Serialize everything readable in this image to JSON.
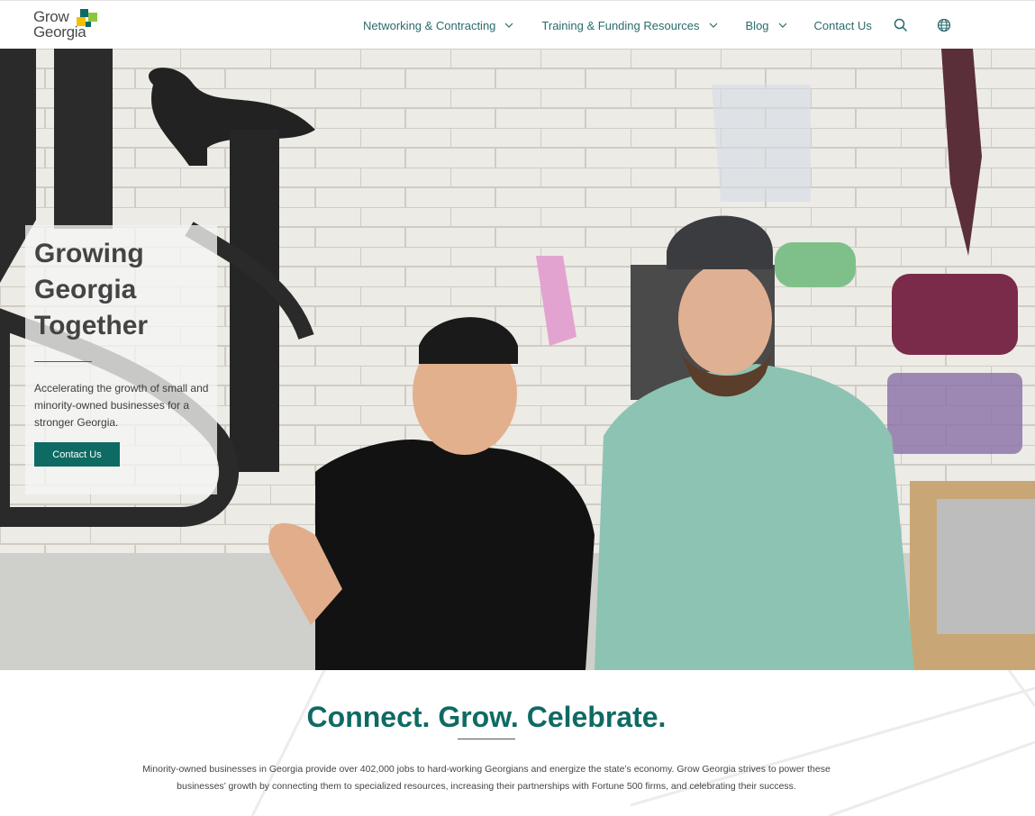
{
  "header": {
    "logo": {
      "line1": "Grow",
      "line2": "Georgia"
    },
    "nav": [
      {
        "label": "Networking & Contracting",
        "has_dropdown": true
      },
      {
        "label": "Training & Funding Resources",
        "has_dropdown": true
      },
      {
        "label": "Blog",
        "has_dropdown": true
      },
      {
        "label": "Contact Us",
        "has_dropdown": false
      }
    ],
    "icons": [
      "search-icon",
      "globe-icon"
    ]
  },
  "hero": {
    "title_lines": [
      "Growing",
      "Georgia",
      "Together"
    ],
    "subtitle": "Accelerating the growth of small and minority-owned businesses for a stronger Georgia.",
    "cta_label": "Contact Us"
  },
  "intro": {
    "heading": "Connect. Grow. Celebrate.",
    "body": "Minority-owned businesses in Georgia provide over 402,000 jobs to hard-working Georgians and energize the state’s economy. Grow Georgia strives to power these businesses’ growth by connecting them to specialized resources, increasing their partnerships with Fortune 500 firms, and celebrating their success."
  },
  "colors": {
    "brand_teal": "#0e6b64",
    "nav_text": "#2a6b6b",
    "logo_green": "#8cc63f",
    "logo_yellow": "#f2c200",
    "logo_teal": "#0e6b64"
  }
}
